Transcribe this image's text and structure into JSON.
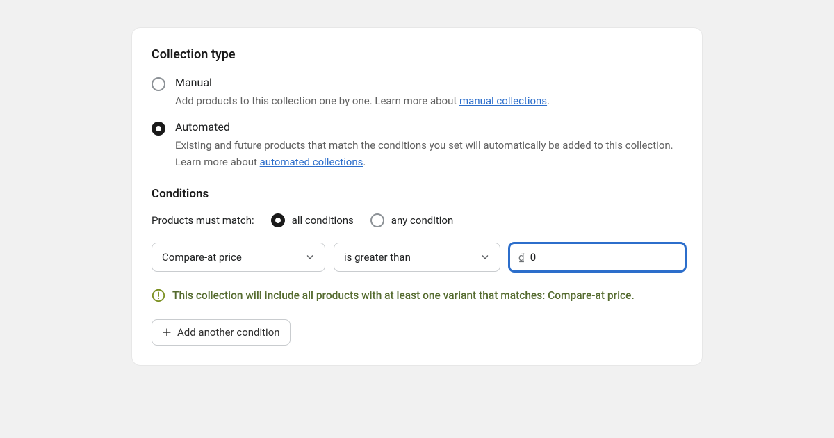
{
  "collection_type": {
    "title": "Collection type",
    "options": {
      "manual": {
        "label": "Manual",
        "desc_pre": "Add products to this collection one by one. Learn more about ",
        "link_text": "manual collections",
        "desc_post": "."
      },
      "automated": {
        "label": "Automated",
        "desc_pre": "Existing and future products that match the conditions you set will automatically be added to this collection. Learn more about ",
        "link_text": "automated collections",
        "desc_post": "."
      }
    },
    "selected": "automated"
  },
  "conditions": {
    "title": "Conditions",
    "match_label": "Products must match:",
    "match_options": {
      "all": "all conditions",
      "any": "any condition"
    },
    "match_selected": "all",
    "rule": {
      "field": "Compare-at price",
      "operator": "is greater than",
      "currency_prefix": "₫",
      "value": "0"
    },
    "info_icon_color": "#7a8f1f",
    "info_text": "This collection will include all products with at least one variant that matches: Compare-at price.",
    "add_button": "Add another condition"
  }
}
